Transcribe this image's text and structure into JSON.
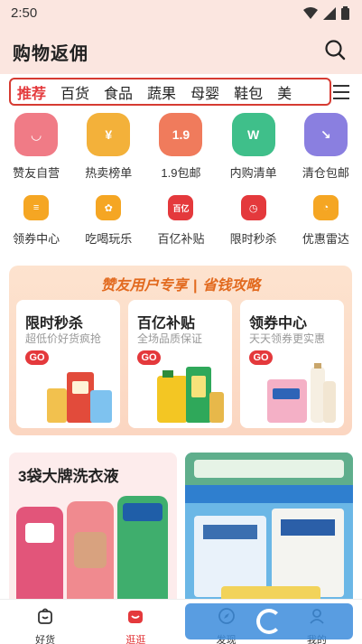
{
  "status": {
    "time": "2:50"
  },
  "app": {
    "title": "购物返佣"
  },
  "tabs": [
    "推荐",
    "百货",
    "食品",
    "蔬果",
    "母婴",
    "鞋包",
    "美"
  ],
  "grid1": [
    {
      "label": "赞友自营",
      "icon": "bag-icon",
      "color": "#f07b86",
      "glyph": "◡"
    },
    {
      "label": "热卖榜单",
      "icon": "coin-icon",
      "color": "#f3b13a",
      "glyph": "¥"
    },
    {
      "label": "1.9包邮",
      "icon": "price-tag-icon",
      "color": "#f07b5c",
      "glyph": "1.9"
    },
    {
      "label": "内购清单",
      "icon": "list-icon",
      "color": "#3fbf8a",
      "glyph": "W"
    },
    {
      "label": "清仓包邮",
      "icon": "clearance-icon",
      "color": "#8a7fe0",
      "glyph": "↘"
    }
  ],
  "grid2": [
    {
      "label": "领券中心",
      "icon": "coupon-icon",
      "color": "#f5a623",
      "glyph": "≡"
    },
    {
      "label": "吃喝玩乐",
      "icon": "film-icon",
      "color": "#f5a623",
      "glyph": "✿"
    },
    {
      "label": "百亿补贴",
      "icon": "subsidy-icon",
      "color": "#e4393c",
      "glyph": "百亿"
    },
    {
      "label": "限时秒杀",
      "icon": "timer-icon",
      "color": "#e4393c",
      "glyph": "◷"
    },
    {
      "label": "优惠雷达",
      "icon": "radar-icon",
      "color": "#f5a623",
      "glyph": "◔"
    }
  ],
  "promo": {
    "left": "赞友用户专享",
    "sep": "|",
    "right": "省钱攻略",
    "cards": [
      {
        "title": "限时秒杀",
        "sub": "超低价好货疯抢",
        "go": "GO"
      },
      {
        "title": "百亿补贴",
        "sub": "全场品质保证",
        "go": "GO"
      },
      {
        "title": "领券中心",
        "sub": "天天领券更实惠",
        "go": "GO"
      }
    ]
  },
  "banners": {
    "left_title": "3袋大牌洗衣液"
  },
  "nav": [
    {
      "label": "好货",
      "icon": "cart-icon"
    },
    {
      "label": "逛逛",
      "icon": "stroll-icon"
    },
    {
      "label": "发现",
      "icon": "discover-icon"
    },
    {
      "label": "我的",
      "icon": "profile-icon"
    }
  ],
  "colors": {
    "accent": "#e4393c",
    "orange": "#e26a1f"
  }
}
